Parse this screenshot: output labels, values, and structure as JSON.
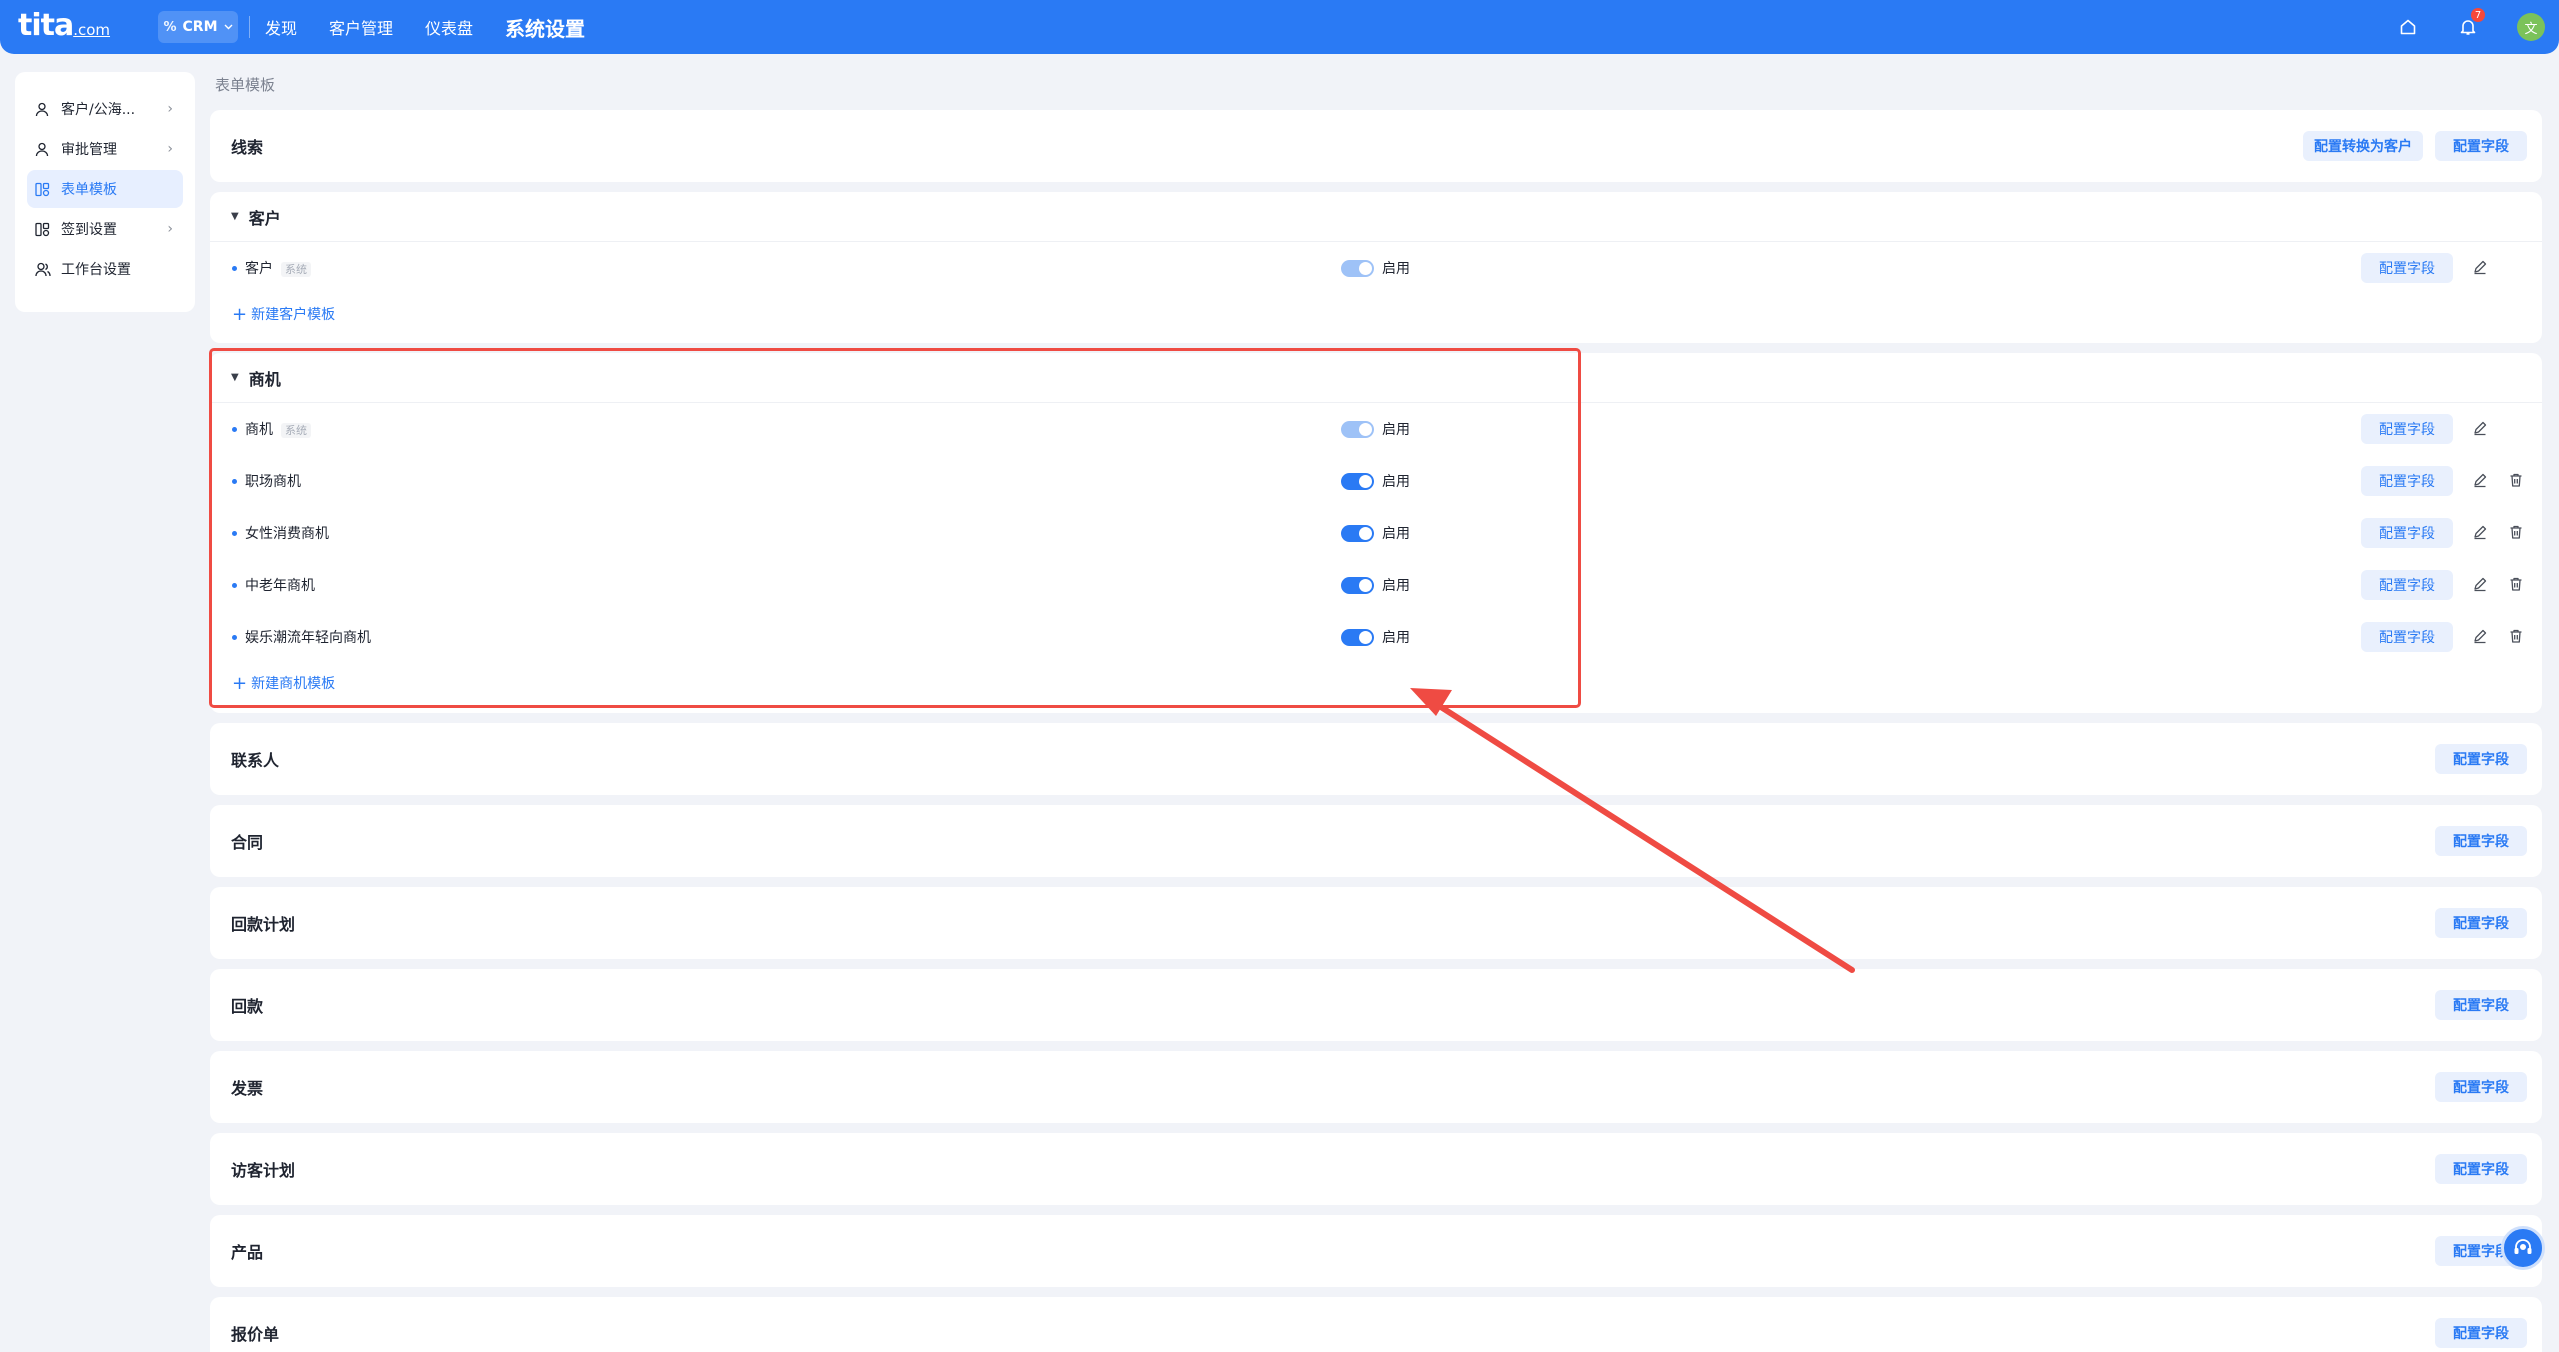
{
  "topbar": {
    "logo": "tita",
    "logo_suffix": ".com",
    "app_switch_label": "CRM",
    "app_switch_icon": "%",
    "nav": [
      "发现",
      "客户管理",
      "仪表盘",
      "系统设置"
    ],
    "notification_count": "7",
    "avatar_text": "文",
    "icons": [
      "home-icon",
      "bell-icon"
    ]
  },
  "sidebar": {
    "items": [
      {
        "label": "客户/公海...",
        "icon": "user-icon",
        "has_chevron": true
      },
      {
        "label": "审批管理",
        "icon": "user-icon",
        "has_chevron": true
      },
      {
        "label": "表单模板",
        "icon": "template-icon",
        "has_chevron": false
      },
      {
        "label": "签到设置",
        "icon": "template-icon",
        "has_chevron": true
      },
      {
        "label": "工作台设置",
        "icon": "people-icon",
        "has_chevron": false
      }
    ]
  },
  "breadcrumb": "表单模板",
  "sections": {
    "lead": {
      "title": "线索",
      "convert_button": "配置转换为客户",
      "config_button": "配置字段"
    },
    "customer": {
      "title": "客户",
      "rows": [
        {
          "name": "客户",
          "tag": "系统",
          "status": "启用"
        }
      ],
      "config_button": "配置字段",
      "add_link": "新建客户模板"
    },
    "opportunity": {
      "title": "商机",
      "rows": [
        {
          "name": "商机",
          "tag": "系统",
          "status": "启用"
        },
        {
          "name": "职场商机",
          "tag": "",
          "status": "启用"
        },
        {
          "name": "女性消费商机",
          "tag": "",
          "status": "启用"
        },
        {
          "name": "中老年商机",
          "tag": "",
          "status": "启用"
        },
        {
          "name": "娱乐潮流年轻向商机",
          "tag": "",
          "status": "启用"
        }
      ],
      "config_button": "配置字段",
      "add_link": "新建商机模板"
    },
    "simple": [
      {
        "title": "联系人",
        "config_button": "配置字段"
      },
      {
        "title": "合同",
        "config_button": "配置字段"
      },
      {
        "title": "回款计划",
        "config_button": "配置字段"
      },
      {
        "title": "回款",
        "config_button": "配置字段"
      },
      {
        "title": "发票",
        "config_button": "配置字段"
      },
      {
        "title": "访客计划",
        "config_button": "配置字段"
      },
      {
        "title": "产品",
        "config_button": "配置字段"
      },
      {
        "title": "报价单",
        "config_button": "配置字段"
      }
    ]
  },
  "colors": {
    "accent": "#2a7af4",
    "highlight": "#ef4b43",
    "background": "#f1f3f8"
  }
}
